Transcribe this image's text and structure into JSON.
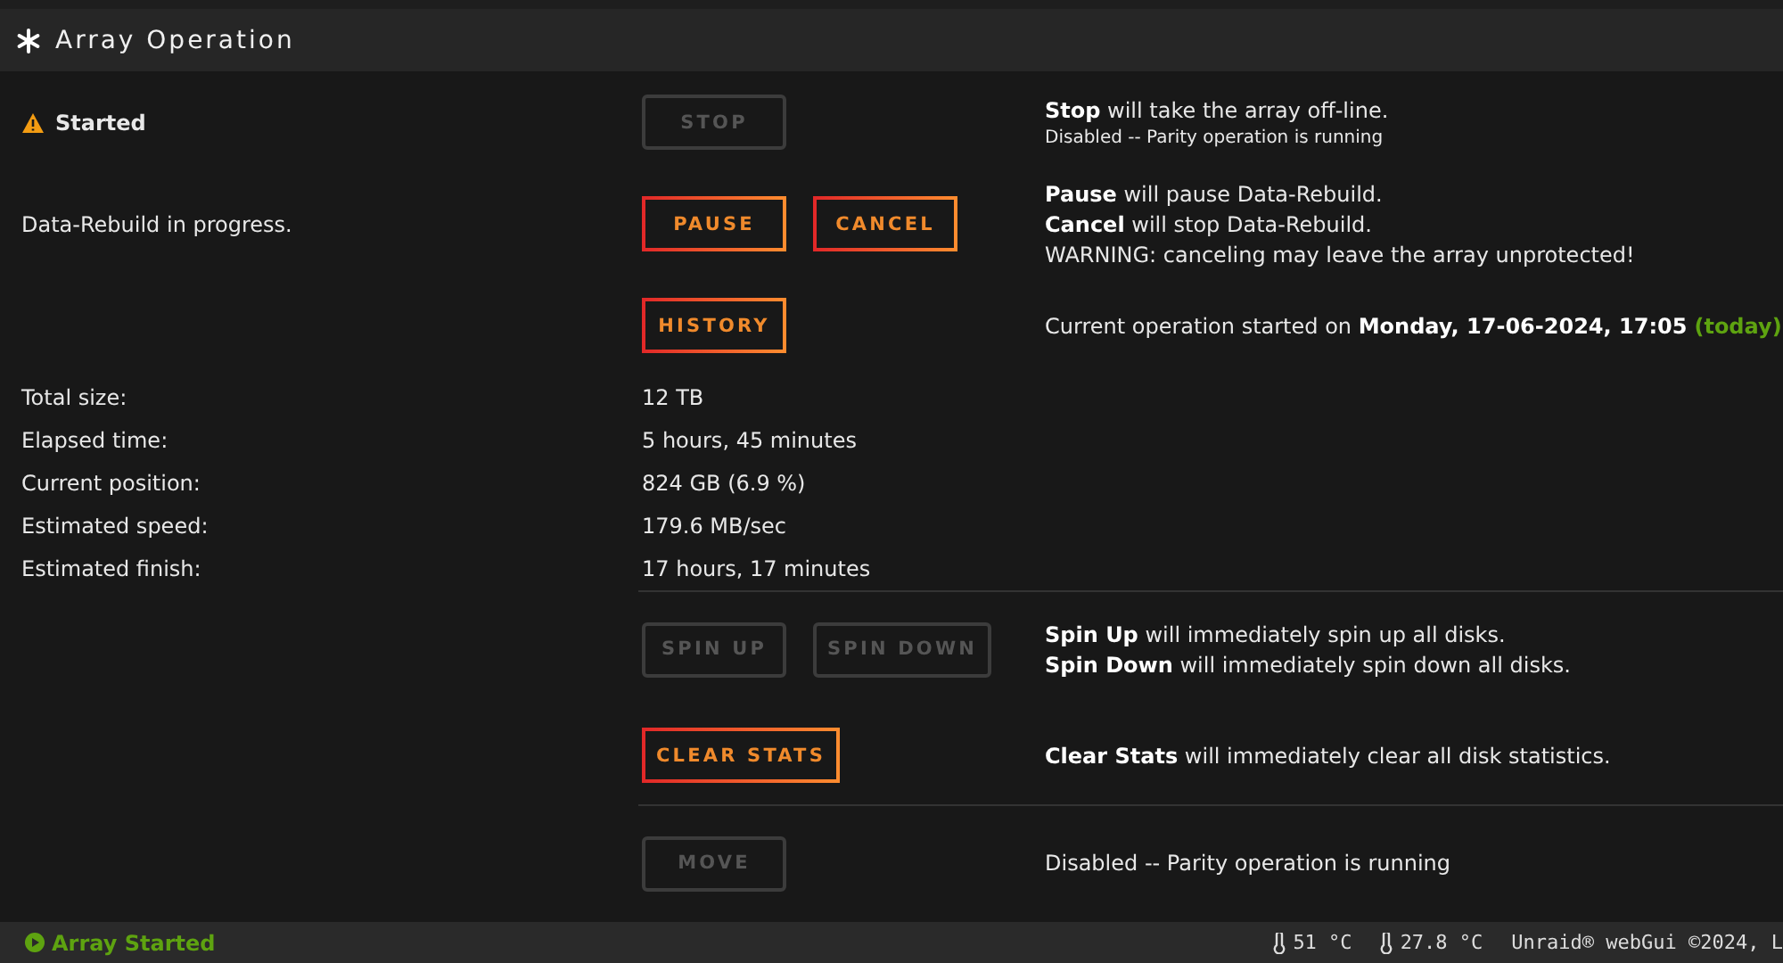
{
  "panel": {
    "title": "Array Operation"
  },
  "operations": [
    {
      "status": {
        "kind": "warning",
        "text": "Started"
      },
      "buttons": [
        {
          "label": "STOP",
          "disabled": true
        }
      ],
      "notes": [
        "**Stop** will take the array off-line."
      ],
      "small_note": "Disabled -- Parity operation is running"
    },
    {
      "status": {
        "kind": "plain",
        "text": "Data-Rebuild in progress."
      },
      "buttons": [
        {
          "label": "PAUSE",
          "disabled": false
        },
        {
          "label": "CANCEL",
          "disabled": false
        }
      ],
      "notes": [
        "**Pause** will pause Data-Rebuild.",
        "**Cancel** will stop Data-Rebuild.",
        "WARNING: canceling may leave the array unprotected!"
      ]
    },
    {
      "buttons": [
        {
          "label": "HISTORY",
          "disabled": false
        }
      ],
      "notes": [
        "Current operation started on **Monday, 17-06-2024, 17:05**"
      ],
      "note_suffix": "(today)"
    }
  ],
  "stats": [
    {
      "label": "Total size:",
      "value": "12 TB"
    },
    {
      "label": "Elapsed time:",
      "value": "5 hours, 45 minutes"
    },
    {
      "label": "Current position:",
      "value": "824 GB (6.9 %)"
    },
    {
      "label": "Estimated speed:",
      "value": "179.6 MB/sec"
    },
    {
      "label": "Estimated finish:",
      "value": "17 hours, 17 minutes"
    }
  ],
  "actions": [
    {
      "buttons": [
        {
          "label": "SPIN UP",
          "disabled": true
        },
        {
          "label": "SPIN DOWN",
          "disabled": true
        }
      ],
      "notes": [
        "**Spin Up** will immediately spin up all disks.",
        "**Spin Down** will immediately spin down all disks."
      ]
    },
    {
      "buttons": [
        {
          "label": "CLEAR STATS",
          "disabled": false
        }
      ],
      "notes": [
        "**Clear Stats** will immediately clear all disk statistics."
      ]
    },
    {
      "divider": true,
      "buttons": [
        {
          "label": "MOVE",
          "disabled": true
        }
      ],
      "notes": [
        "Disabled -- Parity operation is running"
      ]
    }
  ],
  "status_bar": {
    "array_status": "Array Started",
    "temperatures": [
      "51 °C",
      "27.8 °C"
    ],
    "copyright": "Unraid® webGui ©2024, L"
  }
}
